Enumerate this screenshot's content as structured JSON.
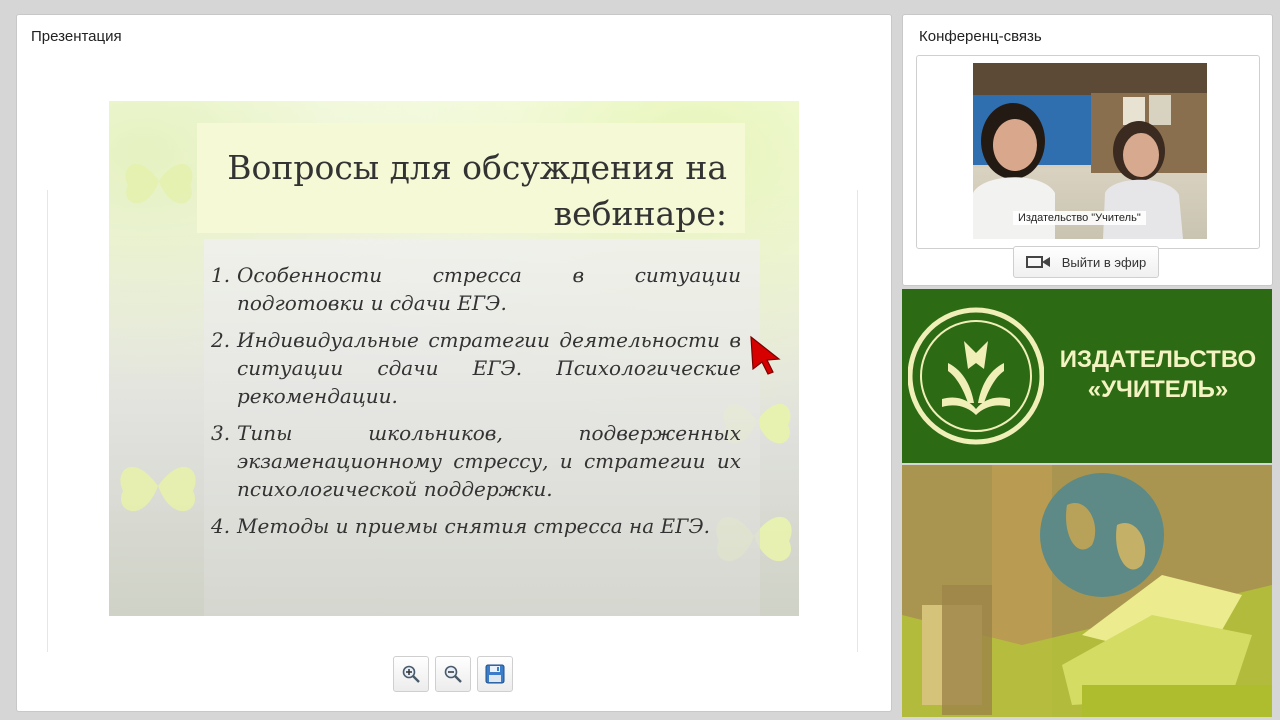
{
  "presentation": {
    "panel_title": "Презентация",
    "slide": {
      "title_line1": "Вопросы для обсуждения на",
      "title_line2": "вебинаре:",
      "items": [
        {
          "num": "1.",
          "text": "Особенности стресса в ситуации подготовки и сдачи ЕГЭ."
        },
        {
          "num": "2.",
          "text": "Индивидуальные стратегии деятельности в ситуации сдачи ЕГЭ. Психологические рекомендации."
        },
        {
          "num": "3.",
          "text": "Типы школьников, подверженных экзаменационному стрессу, и стратегии их психологической поддержки."
        },
        {
          "num": "4.",
          "text": "Методы и приемы снятия стресса на ЕГЭ."
        }
      ]
    },
    "toolbar": {
      "zoom_in_icon": "zoom-in-icon",
      "zoom_out_icon": "zoom-out-icon",
      "save_icon": "save-icon"
    }
  },
  "conference": {
    "panel_title": "Конференц-связь",
    "video_label": "Издательство \"Учитель\"",
    "go_live_label": "Выйти в эфир",
    "go_live_icon": "video-camera-icon"
  },
  "banner": {
    "brand_line1": "ИЗДАТЕЛЬСТВО",
    "brand_line2": "«УЧИТЕЛЬ»",
    "logo_icon": "book-logo-icon",
    "colors": {
      "green": "#2c6a14",
      "text": "#f4f3c2"
    }
  }
}
